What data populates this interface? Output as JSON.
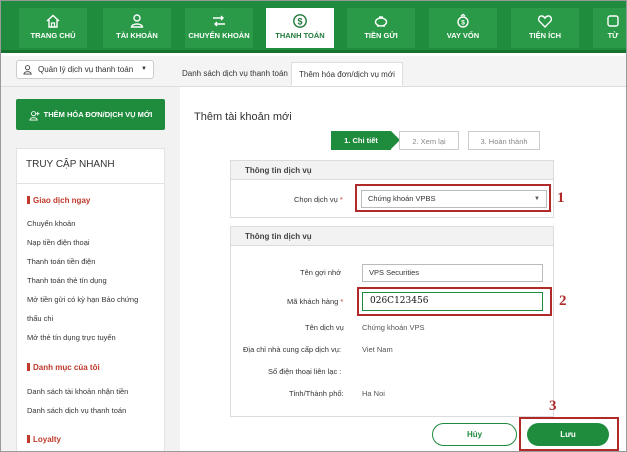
{
  "nav": {
    "items": [
      {
        "label": "TRANG CHỦ",
        "icon": "home-icon"
      },
      {
        "label": "TÀI KHOẢN",
        "icon": "user-icon"
      },
      {
        "label": "CHUYỂN KHOẢN",
        "icon": "transfer-icon"
      },
      {
        "label": "THANH TOÁN",
        "icon": "dollar-icon"
      },
      {
        "label": "TIỀN GỬI",
        "icon": "piggy-bank-icon"
      },
      {
        "label": "VAY VỐN",
        "icon": "loan-icon"
      },
      {
        "label": "TIỆN ÍCH",
        "icon": "heart-icon"
      },
      {
        "label": "TỪ",
        "icon": "more-icon"
      }
    ],
    "active_index": 3
  },
  "subheader": {
    "selector_label": "Quản lý dịch vụ thanh toán",
    "tabs": [
      "Danh sách dịch vụ thanh toán",
      "Thêm hóa đơn/dịch vụ mới"
    ],
    "active_tab": 1
  },
  "sidebar": {
    "add_button": "THÊM HÓA ĐƠN/DỊCH VỤ MỚI",
    "quick_title": "TRUY CẬP NHANH",
    "sections": [
      {
        "title": "Giao dịch ngay",
        "items": [
          "Chuyển khoản",
          "Nạp tiền điện thoại",
          "Thanh toán tiền điện",
          "Thanh toán thẻ tín dụng",
          "Mở tiền gửi có kỳ hạn Bảo chứng",
          "thấu chi",
          "Mở thẻ tín dụng trực tuyến"
        ]
      },
      {
        "title": "Danh mục của tôi",
        "items": [
          "Danh sách tài khoản nhận tiền",
          "Danh sách dịch vụ thanh toán"
        ]
      },
      {
        "title": "Loyalty",
        "items": []
      }
    ]
  },
  "main": {
    "title": "Thêm tài khoản mới",
    "steps": [
      "1. Chi tiết",
      "2. Xem lại",
      "3. Hoàn thành"
    ],
    "panel1": {
      "header": "Thông tin dịch vụ",
      "service_label": "Chọn dịch vụ",
      "service_value": "Chứng khoán VPBS"
    },
    "panel2": {
      "header": "Thông tin dịch vụ",
      "fields": {
        "nickname_label": "Tên gợi nhớ",
        "nickname_value": "VPS Securities",
        "customer_code_label": "Mã khách hàng",
        "customer_code_value": "026C123456",
        "service_name_label": "Tên dịch vụ",
        "service_name_value": "Chứng khoán VPS",
        "provider_address_label": "Địa chỉ nhà cung cấp dịch vụ:",
        "provider_address_value": "Viet Nam",
        "phone_label": "Số điện thoại liên lạc :",
        "city_label": "Tỉnh/Thành phố:",
        "city_value": "Ha Noi"
      }
    },
    "buttons": {
      "cancel": "Hủy",
      "save": "Lưu"
    }
  },
  "annotations": [
    "1",
    "2",
    "3"
  ],
  "colors": {
    "brand_green": "#1f8b3d",
    "annotation_red": "#b02a2a",
    "required_star": "#c0392b"
  }
}
